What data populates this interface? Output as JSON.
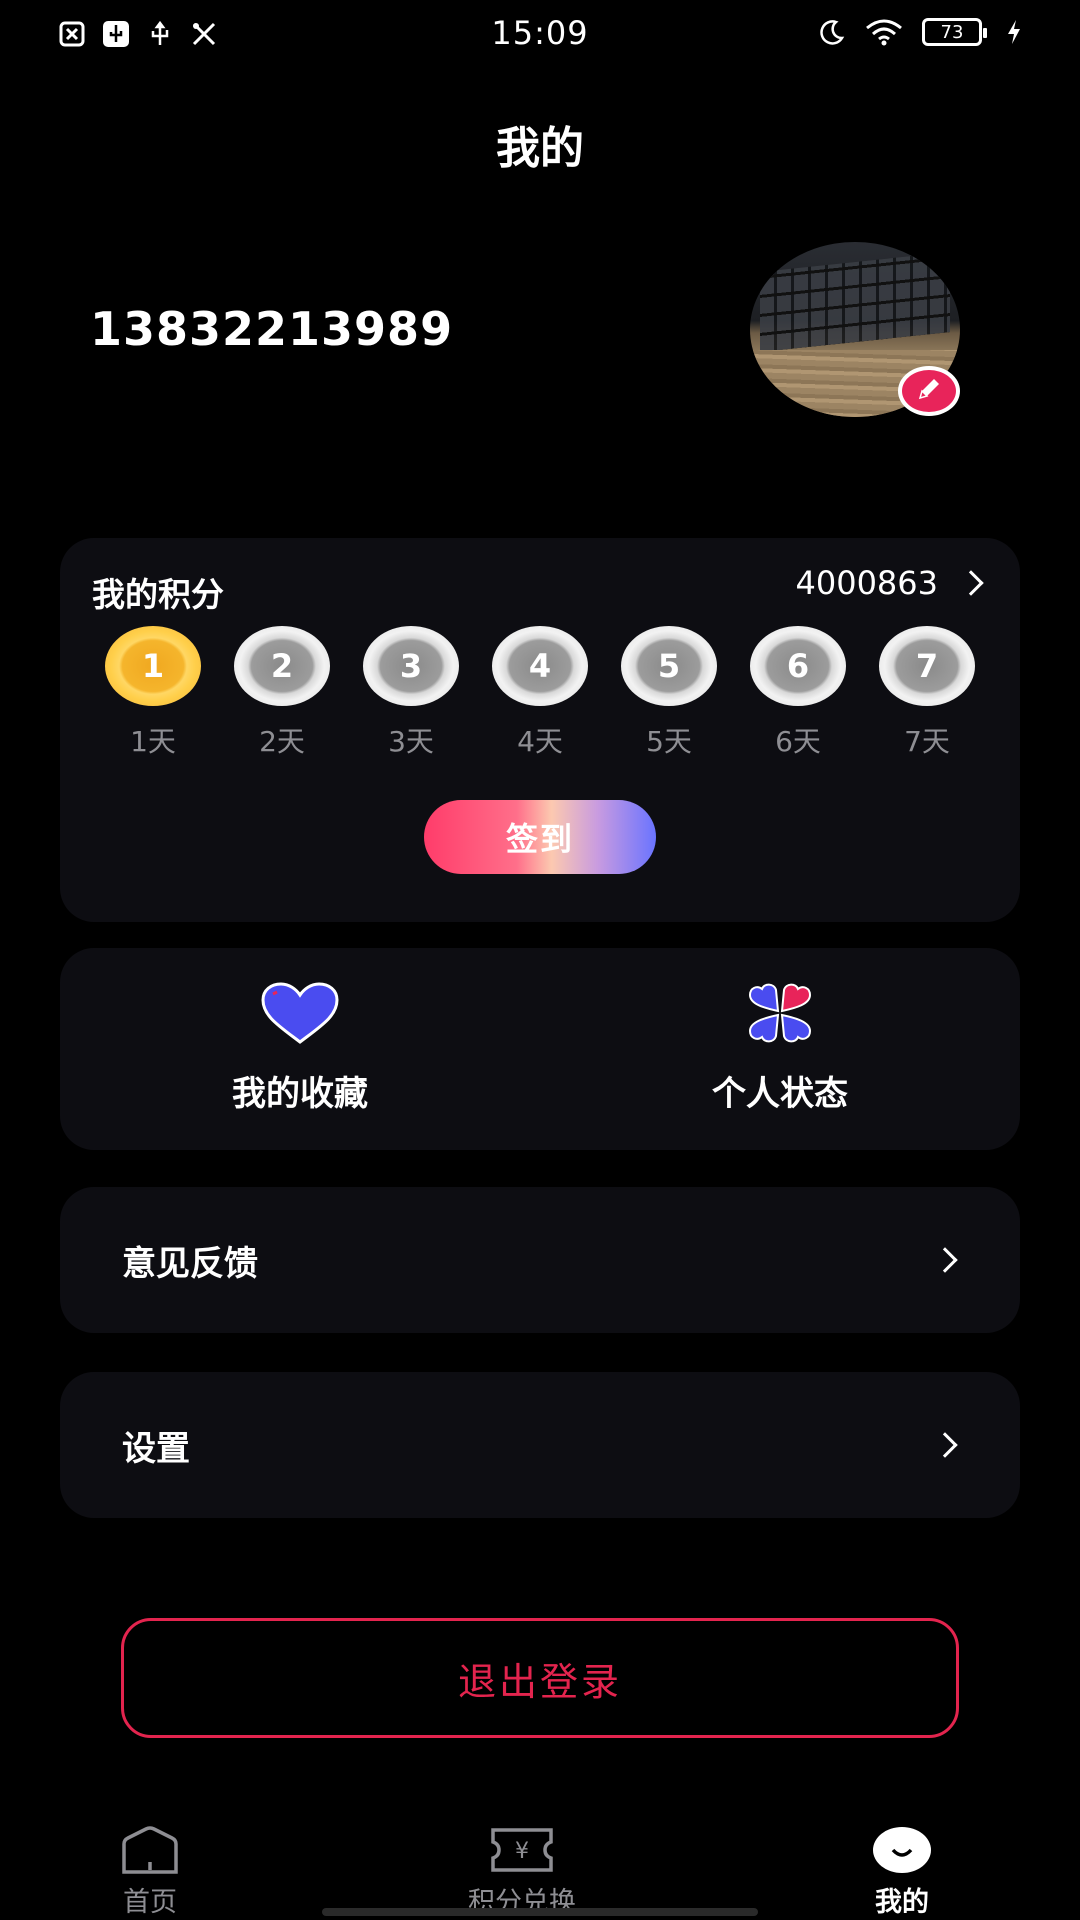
{
  "status_bar": {
    "time": "15:09",
    "battery": "73",
    "left_icons": [
      "close-box-icon",
      "usb-box-icon",
      "usb-icon",
      "tools-icon"
    ],
    "right_icons": [
      "moon-icon",
      "wifi-icon",
      "battery-icon",
      "charging-icon"
    ]
  },
  "header": {
    "title": "我的"
  },
  "profile": {
    "phone": "13832213989"
  },
  "points": {
    "label": "我的积分",
    "value": "4000863",
    "days": [
      {
        "num": "1",
        "label": "1天",
        "claimed": true
      },
      {
        "num": "2",
        "label": "2天",
        "claimed": false
      },
      {
        "num": "3",
        "label": "3天",
        "claimed": false
      },
      {
        "num": "4",
        "label": "4天",
        "claimed": false
      },
      {
        "num": "5",
        "label": "5天",
        "claimed": false
      },
      {
        "num": "6",
        "label": "6天",
        "claimed": false
      },
      {
        "num": "7",
        "label": "7天",
        "claimed": false
      }
    ],
    "signin_label": "签到"
  },
  "quick_actions": {
    "favorites": "我的收藏",
    "status": "个人状态"
  },
  "menu": {
    "feedback": "意见反馈",
    "settings": "设置"
  },
  "logout_label": "退出登录",
  "bottom_nav": {
    "home": "首页",
    "exchange": "积分兑换",
    "mine": "我的"
  },
  "colors": {
    "accent": "#e3244e",
    "card_bg": "#0d0d12",
    "heart": "#4a4cf0"
  }
}
